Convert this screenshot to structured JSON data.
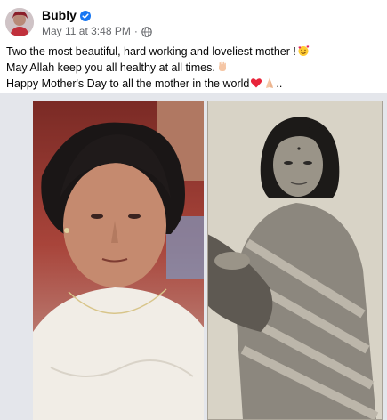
{
  "post": {
    "author": "Bubly",
    "date": "May 11 at 3:48 PM",
    "separator": "·",
    "lines": [
      "Two the most beautiful, hard working and loveliest mother !",
      "May Allah keep you all healthy at all times.",
      "Happy Mother's Day to all the mother in the world"
    ],
    "trailing": ".."
  },
  "icons": {
    "verified": "verified-badge-icon",
    "privacy": "globe-icon",
    "line1_emoji": "smiling-face-with-hearts-emoji",
    "line2_emoji": "waving-hand-emoji",
    "line3_emoji_1": "red-heart-emoji",
    "line3_emoji_2": "folded-hands-emoji"
  },
  "colors": {
    "verified": "#1877f2",
    "text": "#050505",
    "secondary": "#65676b",
    "gallery_bg": "#e4e6eb"
  }
}
